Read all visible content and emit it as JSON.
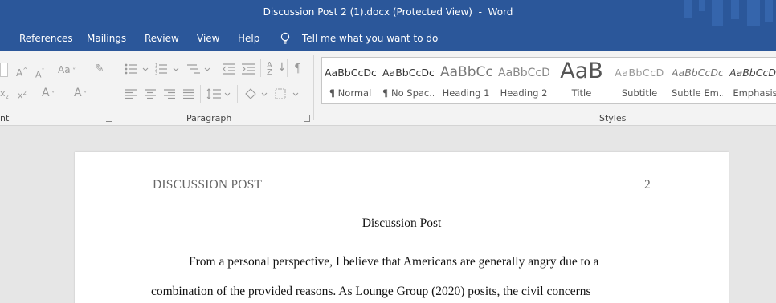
{
  "window": {
    "title": "Discussion Post 2 (1).docx (Protected View)  -  Word"
  },
  "menu": {
    "tabs": [
      "References",
      "Mailings",
      "Review",
      "View",
      "Help"
    ],
    "tell_me": "Tell me what you want to do"
  },
  "ribbon": {
    "font_group_label": "nt",
    "paragraph_group_label": "Paragraph",
    "styles_group_label": "Styles",
    "styles": [
      {
        "preview": "AaBbCcDc",
        "name": "¶ Normal"
      },
      {
        "preview": "AaBbCcDc",
        "name": "¶ No Spac..."
      },
      {
        "preview": "AaBbCc",
        "name": "Heading 1"
      },
      {
        "preview": "AaBbCcD",
        "name": "Heading 2"
      },
      {
        "preview": "AaB",
        "name": "Title"
      },
      {
        "preview": "AaBbCcD",
        "name": "Subtitle"
      },
      {
        "preview": "AaBbCcDc",
        "name": "Subtle Em..."
      },
      {
        "preview": "AaBbCcDc",
        "name": "Emphasis"
      }
    ]
  },
  "document": {
    "running_head": "DISCUSSION POST",
    "page_number": "2",
    "title": "Discussion Post",
    "lines": [
      "From a personal perspective, I believe that Americans are generally angry due to a",
      "combination of the provided reasons. As Lounge Group (2020) posits, the civil concerns"
    ]
  },
  "colors": {
    "titlebar": "#2b579a",
    "ribbon": "#f3f3f3",
    "canvas": "#e6e6e6"
  }
}
